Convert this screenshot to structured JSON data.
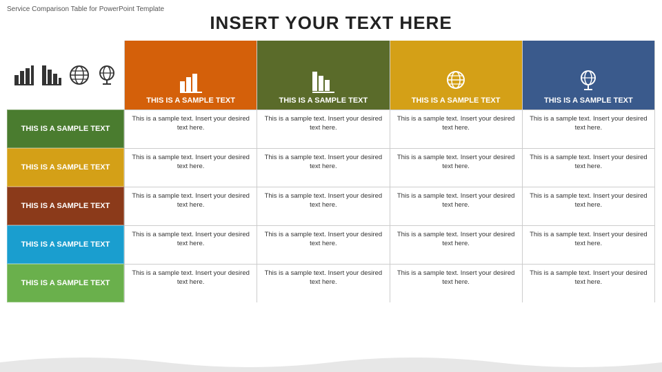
{
  "watermark": "Service Comparison Table for PowerPoint Template",
  "title": "INSERT YOUR TEXT HERE",
  "columns": [
    {
      "id": "col1",
      "color": "color-orange",
      "iconType": "bar-chart",
      "headerText": "THIS IS A SAMPLE TEXT"
    },
    {
      "id": "col2",
      "color": "color-olive",
      "iconType": "bar-chart-down",
      "headerText": "THIS IS A SAMPLE TEXT"
    },
    {
      "id": "col3",
      "color": "color-yellow",
      "iconType": "globe",
      "headerText": "THIS IS A SAMPLE TEXT"
    },
    {
      "id": "col4",
      "color": "color-blue",
      "iconType": "globe-stand",
      "headerText": "THIS IS A SAMPLE TEXT"
    }
  ],
  "rows": [
    {
      "labelColor": "color-green-row",
      "label": "THIS IS A SAMPLE TEXT",
      "cells": [
        "This is a sample text. Insert your desired text here.",
        "This is a sample text. Insert your desired text here.",
        "This is a sample text. Insert your desired text here.",
        "This is a sample text. Insert your desired text here."
      ]
    },
    {
      "labelColor": "color-yellow-row",
      "label": "THIS IS A SAMPLE TEXT",
      "cells": [
        "This is a sample text. Insert your desired text here.",
        "This is a sample text. Insert your desired text here.",
        "This is a sample text. Insert your desired text here.",
        "This is a sample text. Insert your desired text here."
      ]
    },
    {
      "labelColor": "color-brown-row",
      "label": "THIS IS A SAMPLE TEXT",
      "cells": [
        "This is a sample text. Insert your desired text here.",
        "This is a sample text. Insert your desired text here.",
        "This is a sample text. Insert your desired text here.",
        "This is a sample text. Insert your desired text here."
      ]
    },
    {
      "labelColor": "color-cyan-row",
      "label": "THIS IS A SAMPLE TEXT",
      "cells": [
        "This is a sample text. Insert your desired text here.",
        "This is a sample text. Insert your desired text here.",
        "This is a sample text. Insert your desired text here.",
        "This is a sample text. Insert your desired text here."
      ]
    },
    {
      "labelColor": "color-lime-row",
      "label": "THIS IS A SAMPLE TEXT",
      "cells": [
        "This is a sample text. Insert your desired text here.",
        "This is a sample text. Insert your desired text here.",
        "This is a sample text. Insert your desired text here.",
        "This is a sample text. Insert your desired text here."
      ]
    }
  ],
  "topIcons": [
    {
      "type": "bar-chart",
      "label": "bar-chart-icon-1"
    },
    {
      "type": "bar-chart-outline",
      "label": "bar-chart-icon-2"
    },
    {
      "type": "globe-filled",
      "label": "globe-icon-1"
    },
    {
      "type": "globe-stand",
      "label": "globe-stand-icon-1"
    }
  ]
}
